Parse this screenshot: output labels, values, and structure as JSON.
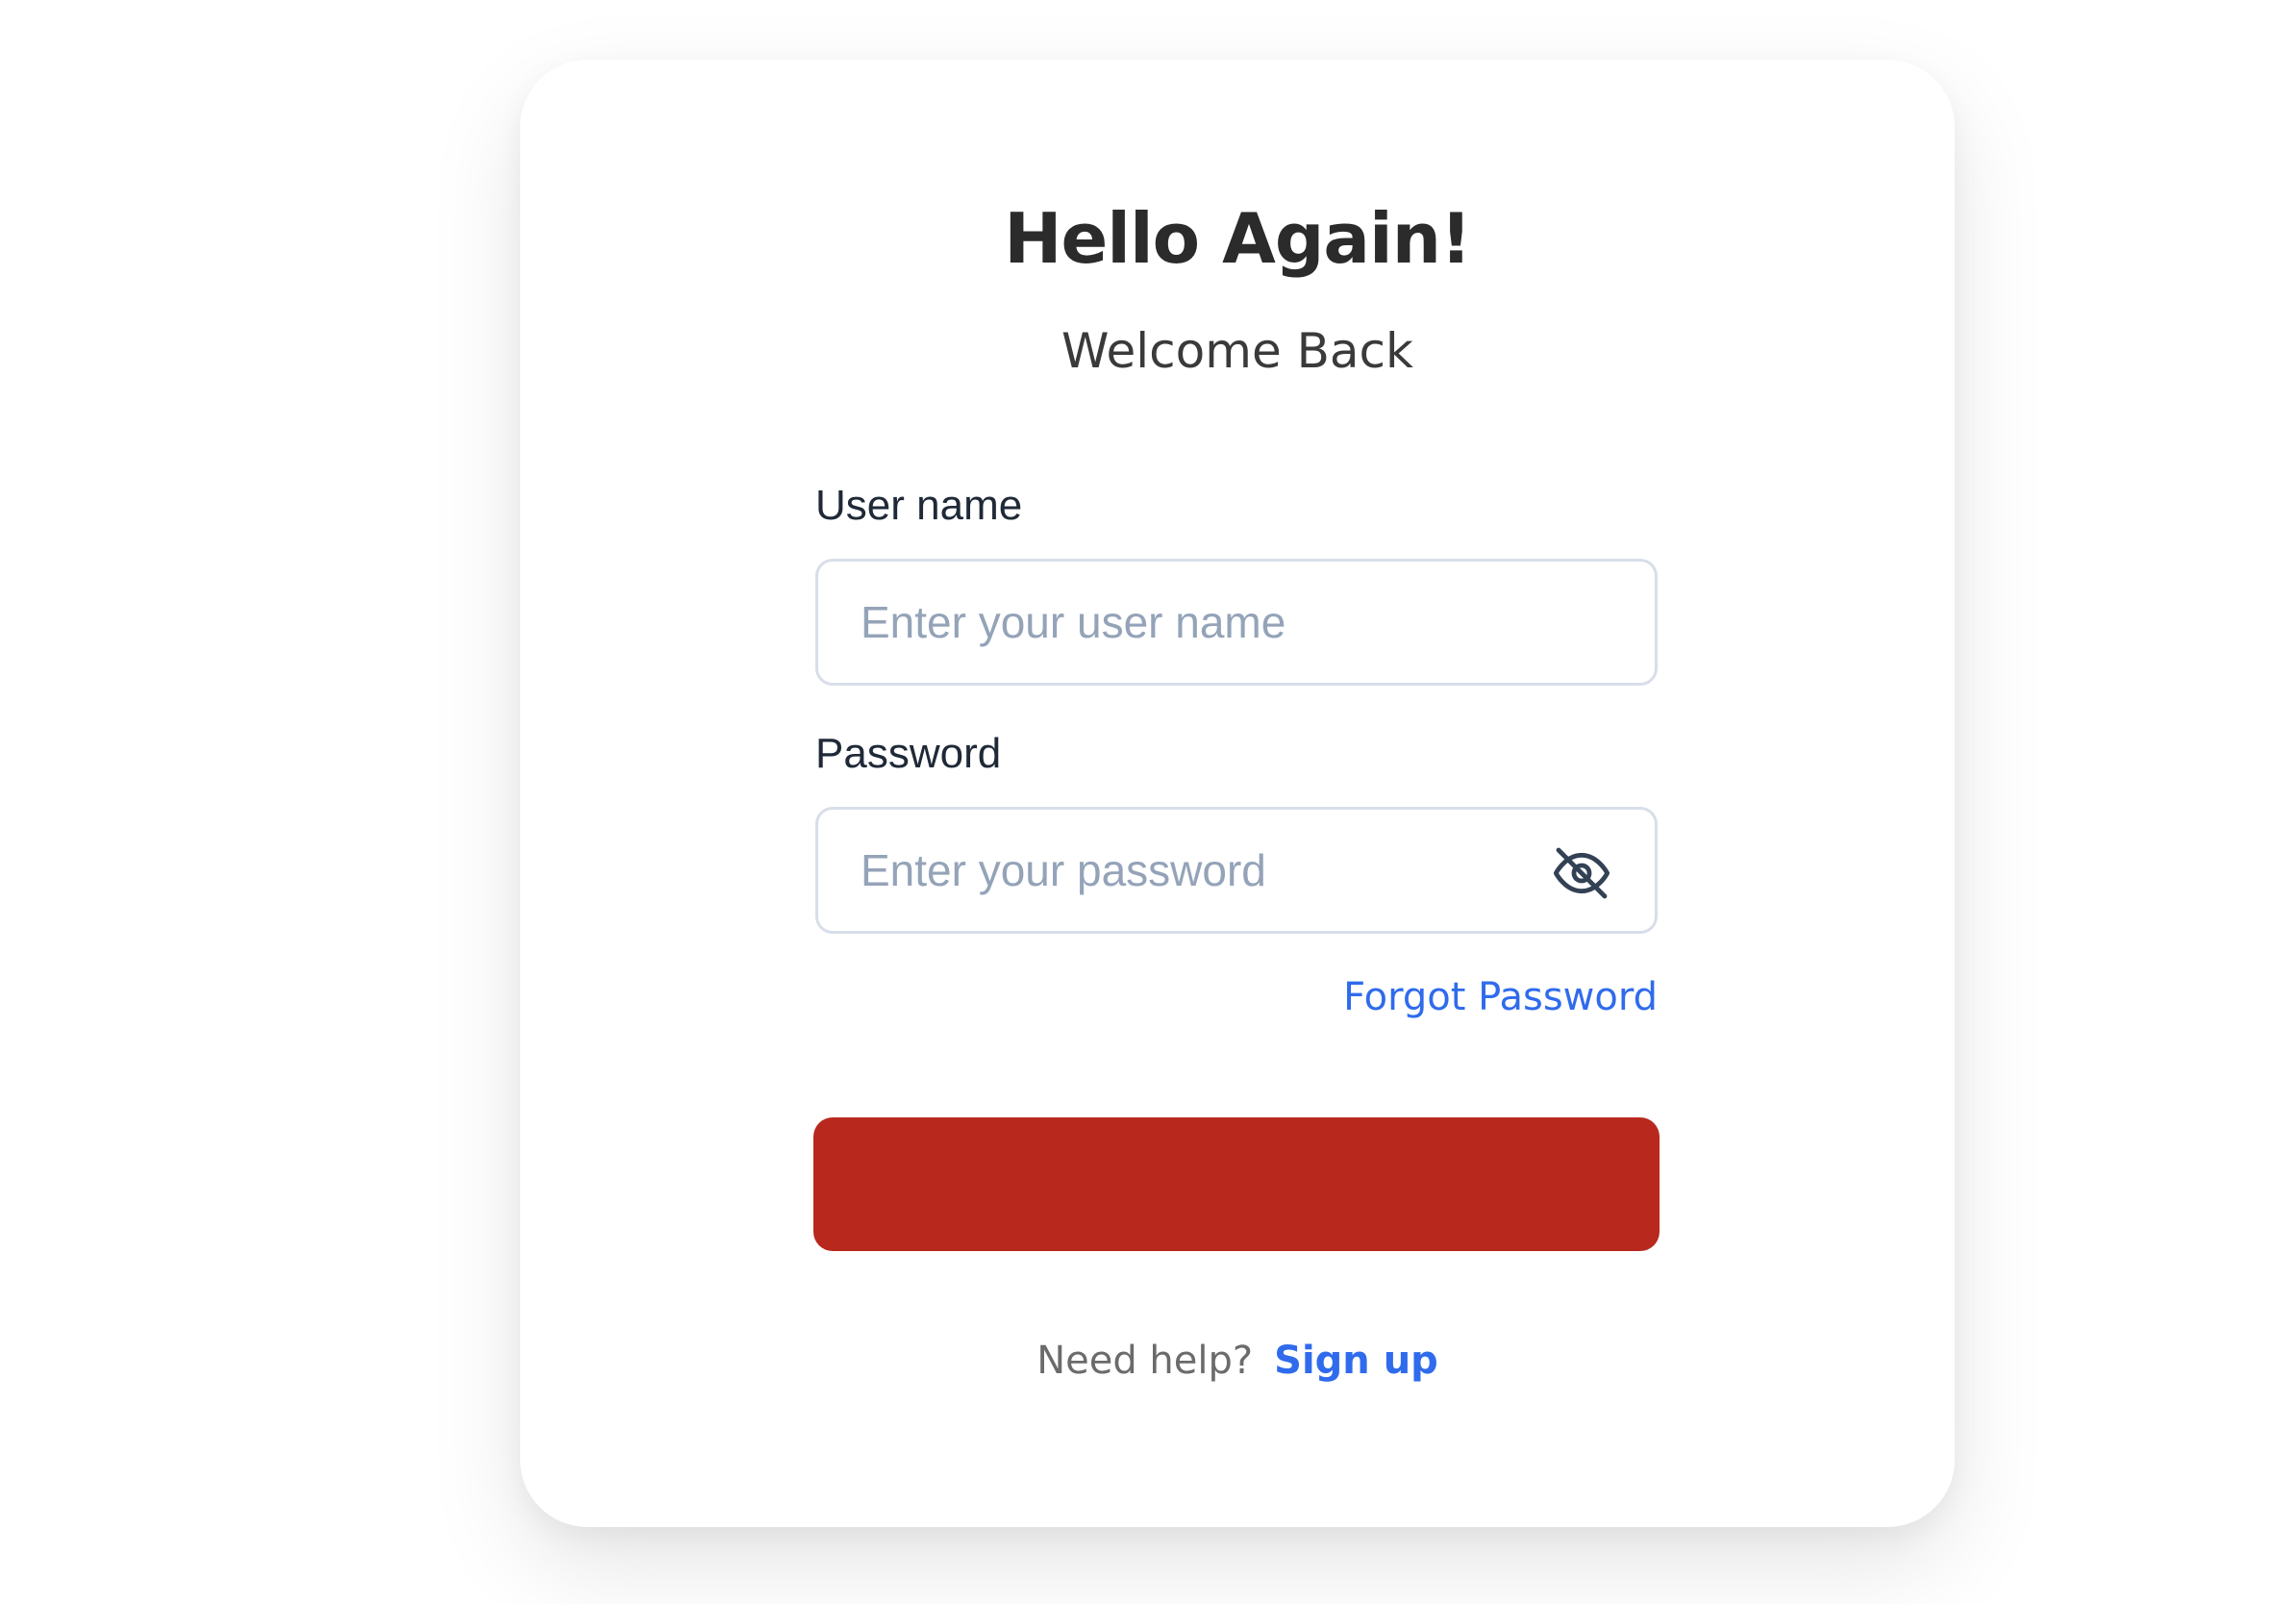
{
  "header": {
    "title": "Hello Again!",
    "subtitle": "Welcome Back"
  },
  "form": {
    "username": {
      "label": "User name",
      "value": "",
      "placeholder": "Enter your user name"
    },
    "password": {
      "label": "Password",
      "value": "",
      "placeholder": "Enter your password",
      "toggle_icon": "eye-off-icon"
    },
    "forgot_label": "Forgot Password",
    "submit_label": ""
  },
  "footer": {
    "help_text": "Need help?",
    "signup_label": "Sign up"
  },
  "colors": {
    "accent": "#2f6bec",
    "button": "#b8281d",
    "title": "#2b2b2b"
  }
}
